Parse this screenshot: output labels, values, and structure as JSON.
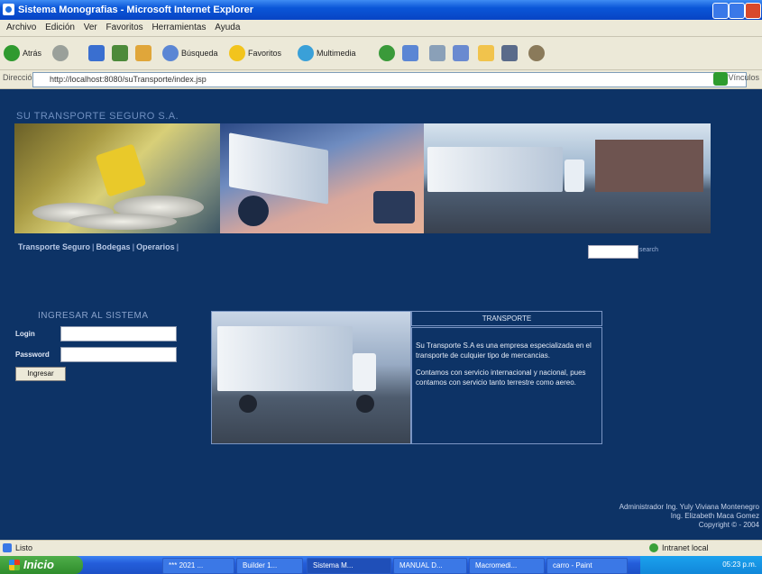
{
  "window": {
    "title": "Sistema Monografias - Microsoft Internet Explorer",
    "menu": [
      "Archivo",
      "Edición",
      "Ver",
      "Favoritos",
      "Herramientas",
      "Ayuda"
    ]
  },
  "toolbar": {
    "back": "Atrás",
    "search": "Búsqueda",
    "favorites": "Favoritos",
    "multimedia": "Multimedia"
  },
  "address": {
    "label": "Dirección",
    "url": "http://localhost:8080/suTransporte/index.jsp",
    "links": "Vínculos"
  },
  "page": {
    "brand": "SU TRANSPORTE SEGURO S.A.",
    "nav": [
      "Transporte Seguro",
      "Bodegas",
      "Operarios"
    ],
    "search_link": "search",
    "login": {
      "title": "INGRESAR AL SISTEMA",
      "login_label": "Login",
      "password_label": "Password",
      "submit": "Ingresar"
    },
    "panel": {
      "title": "TRANSPORTE",
      "paragraph1": "Su Transporte S.A es una empresa especializada en el transporte de culquier tipo de mercancias.",
      "paragraph2": "Contamos con servicio internacional y nacional, pues contamos con servicio tanto terrestre como aereo."
    },
    "credits": {
      "line1": "Administrador Ing. Yuly Viviana Montenegro",
      "line2": "Ing. Elizabeth Maca Gomez",
      "line3": "Copyright © - 2004"
    }
  },
  "status": {
    "left": "Listo",
    "right": "Intranet local"
  },
  "taskbar": {
    "start": "Inicio",
    "tasks": [
      "*** 2021 ...",
      "Builder 1...",
      "Sistema M...",
      "MANUAL D...",
      "Macromedi...",
      "carro - Paint"
    ],
    "clock": "05:23 p.m."
  }
}
